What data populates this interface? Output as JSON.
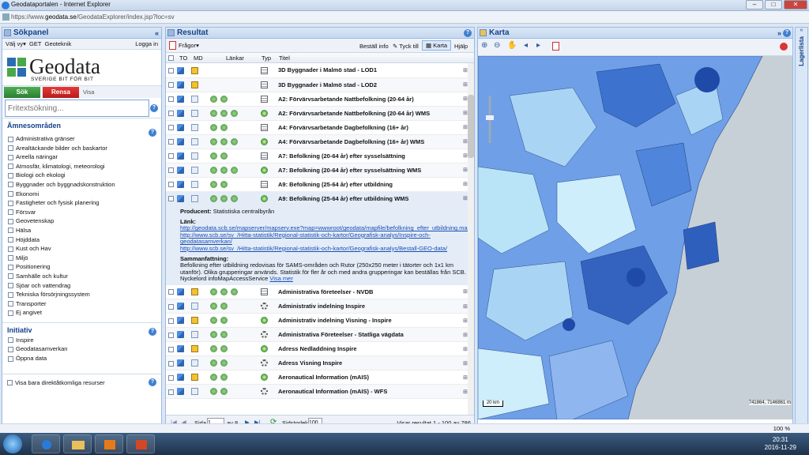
{
  "window": {
    "title": "Geodataportalen - Internet Explorer",
    "url_prefix": "https://www.",
    "url_domain": "geodata.se",
    "url_path": "/GeodataExplorer/index.jsp?loc=sv"
  },
  "sokpanel": {
    "title": "Sökpanel",
    "menu_view": "Välj vy",
    "menu_get": "GET",
    "menu_geo": "Geoteknik",
    "login": "Logga in",
    "logo_text": "Geodata",
    "logo_sub": "SVERIGE BIT FÖR BIT",
    "btn_search": "Sök",
    "btn_clear": "Rensa",
    "btn_show": "Visa",
    "search_placeholder": "Fritextsökning...",
    "subjects_title": "Ämnesområden",
    "subjects": [
      "Administrativa gränser",
      "Arealtäckande bilder och baskartor",
      "Areella näringar",
      "Atmosfär, klimatologi, meteorologi",
      "Biologi och ekologi",
      "Byggnader och byggnadskonstruktion",
      "Ekonomi",
      "Fastigheter och fysisk planering",
      "Försvar",
      "Geovetenskap",
      "Hälsa",
      "Höjddata",
      "Kust och Hav",
      "Miljö",
      "Positionering",
      "Samhälle och kultur",
      "Sjöar och vattendrag",
      "Tekniska försörjningssystem",
      "Transporter",
      "Ej angivet"
    ],
    "initiative_title": "Initiativ",
    "initiatives": [
      "Inspire",
      "Geodatasamverkan",
      "Öppna data"
    ],
    "direct_access": "Visa bara direktåtkomliga resurser"
  },
  "resultat": {
    "title": "Resultat",
    "questions": "Frågor",
    "btn_order": "Beställ info",
    "btn_feedback": "Tyck till",
    "btn_map": "Karta",
    "btn_help": "Hjälp",
    "col_to": "TO",
    "col_md": "MD",
    "col_links": "Länkar",
    "col_type": "Typ",
    "col_title": "Titel",
    "rows_top": [
      "3D Byggnader i Malmö stad - LOD1",
      "3D Byggnader i Malmö stad - LOD2",
      "A2: Förvärvsarbetande Nattbefolkning (20-64 år)",
      "A2: Förvärvsarbetande Nattbefolkning (20-64 år) WMS",
      "A4: Förvärvsarbetande Dagbefolkning (16+ år)",
      "A4: Förvärvsarbetande Dagbefolkning (16+ år) WMS",
      "A7: Befolkning (20-64 år) efter sysselsättning",
      "A7: Befolkning (20-64 år) efter sysselsättning WMS",
      "A9: Befolkning (25-64 år) efter utbildning",
      "A9: Befolkning (25-64 år) efter utbildning WMS"
    ],
    "detail": {
      "producer_label": "Producent:",
      "producer": "Statistiska centralbyrån",
      "links_label": "Länk:",
      "link1": "http://geodata.scb.se/mapserver/mapserv.exe?map=wwwroot/geodata/mapfile/befolkning_efter_utbildning.map",
      "link2": "http://www.scb.se/sv_/Hitta-statistik/Regional-statistik-och-kartor/Geografisk-analys/Inspire-och-",
      "link2b": "geodatasamverkan/",
      "link3": "http://www.scb.se/sv_/Hitta-statistik/Regional-statistik-och-kartor/Geografisk-analys/Bestall-GEO-data/",
      "summary_label": "Sammanfattning:",
      "summary": "Befolkning efter utbildning redovisas för SAMS-områden och Rutor (250x250 meter i tätorter och 1x1 km utanför). Olika grupperingar används. Statistik för fler år och med andra grupperingar kan beställas från SCB. Nyckelord infoMapAccessService",
      "more": "Visa mer"
    },
    "rows_bottom": [
      "Administrativa företeelser - NVDB",
      "Administrativ indelning Inspire",
      "Administrativ indelning Visning - Inspire",
      "Administrativa Företeelser - Statliga vägdata",
      "Adress Nedladdning Inspire",
      "Adress Visning Inspire",
      "Aeronautical Information (mAIS)",
      "Aeronautical Information (mAIS) - WFS"
    ],
    "pager_page": "Sida",
    "pager_value": "1",
    "pager_of": "av 8",
    "page_size_label": "Sidstorlek",
    "page_size": "100",
    "showing": "Visar resultat 1 - 100 av 786"
  },
  "karta": {
    "title": "Karta",
    "side_tab": "Lagerlista",
    "scale": "20 km",
    "coords": "741864, 7146861 m",
    "zoom": "100 %"
  },
  "taskbar": {
    "time": "20:31",
    "date": "2016-11-29"
  }
}
